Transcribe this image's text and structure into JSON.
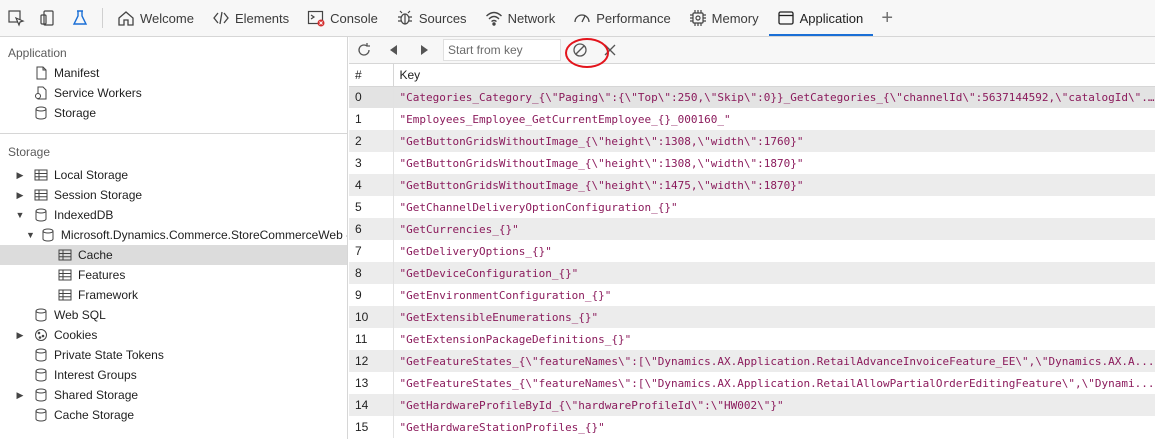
{
  "toolbar_tabs": [
    {
      "label": "Welcome",
      "icon": "home-icon"
    },
    {
      "label": "Elements",
      "icon": "code-icon"
    },
    {
      "label": "Console",
      "icon": "console-icon"
    },
    {
      "label": "Sources",
      "icon": "bug-icon"
    },
    {
      "label": "Network",
      "icon": "wifi-icon"
    },
    {
      "label": "Performance",
      "icon": "gauge-icon"
    },
    {
      "label": "Memory",
      "icon": "chip-icon"
    },
    {
      "label": "Application",
      "icon": "window-icon"
    }
  ],
  "sidebar": {
    "application_title": "Application",
    "application_items": [
      "Manifest",
      "Service Workers",
      "Storage"
    ],
    "storage_title": "Storage",
    "storage_items": {
      "local_storage": "Local Storage",
      "session_storage": "Session Storage",
      "indexeddb": "IndexedDB",
      "database": "Microsoft.Dynamics.Commerce.StoreCommerceWeb -",
      "cache": "Cache",
      "features": "Features",
      "framework": "Framework",
      "web_sql": "Web SQL",
      "cookies": "Cookies",
      "private_state_tokens": "Private State Tokens",
      "interest_groups": "Interest Groups",
      "shared_storage": "Shared Storage",
      "cache_storage": "Cache Storage"
    }
  },
  "main": {
    "key_input_placeholder": "Start from key",
    "col_num": "#",
    "col_key": "Key",
    "rows": [
      {
        "num": "0",
        "key": "\"Categories_Category_{\\\"Paging\\\":{\\\"Top\\\":250,\\\"Skip\\\":0}}_GetCategories_{\\\"channelId\\\":5637144592,\\\"catalogId\\\"..."
      },
      {
        "num": "1",
        "key": "\"Employees_Employee_GetCurrentEmployee_{}_000160_\""
      },
      {
        "num": "2",
        "key": "\"GetButtonGridsWithoutImage_{\\\"height\\\":1308,\\\"width\\\":1760}\""
      },
      {
        "num": "3",
        "key": "\"GetButtonGridsWithoutImage_{\\\"height\\\":1308,\\\"width\\\":1870}\""
      },
      {
        "num": "4",
        "key": "\"GetButtonGridsWithoutImage_{\\\"height\\\":1475,\\\"width\\\":1870}\""
      },
      {
        "num": "5",
        "key": "\"GetChannelDeliveryOptionConfiguration_{}\""
      },
      {
        "num": "6",
        "key": "\"GetCurrencies_{}\""
      },
      {
        "num": "7",
        "key": "\"GetDeliveryOptions_{}\""
      },
      {
        "num": "8",
        "key": "\"GetDeviceConfiguration_{}\""
      },
      {
        "num": "9",
        "key": "\"GetEnvironmentConfiguration_{}\""
      },
      {
        "num": "10",
        "key": "\"GetExtensibleEnumerations_{}\""
      },
      {
        "num": "11",
        "key": "\"GetExtensionPackageDefinitions_{}\""
      },
      {
        "num": "12",
        "key": "\"GetFeatureStates_{\\\"featureNames\\\":[\\\"Dynamics.AX.Application.RetailAdvanceInvoiceFeature_EE\\\",\\\"Dynamics.AX.A..."
      },
      {
        "num": "13",
        "key": "\"GetFeatureStates_{\\\"featureNames\\\":[\\\"Dynamics.AX.Application.RetailAllowPartialOrderEditingFeature\\\",\\\"Dynami..."
      },
      {
        "num": "14",
        "key": "\"GetHardwareProfileById_{\\\"hardwareProfileId\\\":\\\"HW002\\\"}\""
      },
      {
        "num": "15",
        "key": "\"GetHardwareStationProfiles_{}\""
      }
    ]
  }
}
